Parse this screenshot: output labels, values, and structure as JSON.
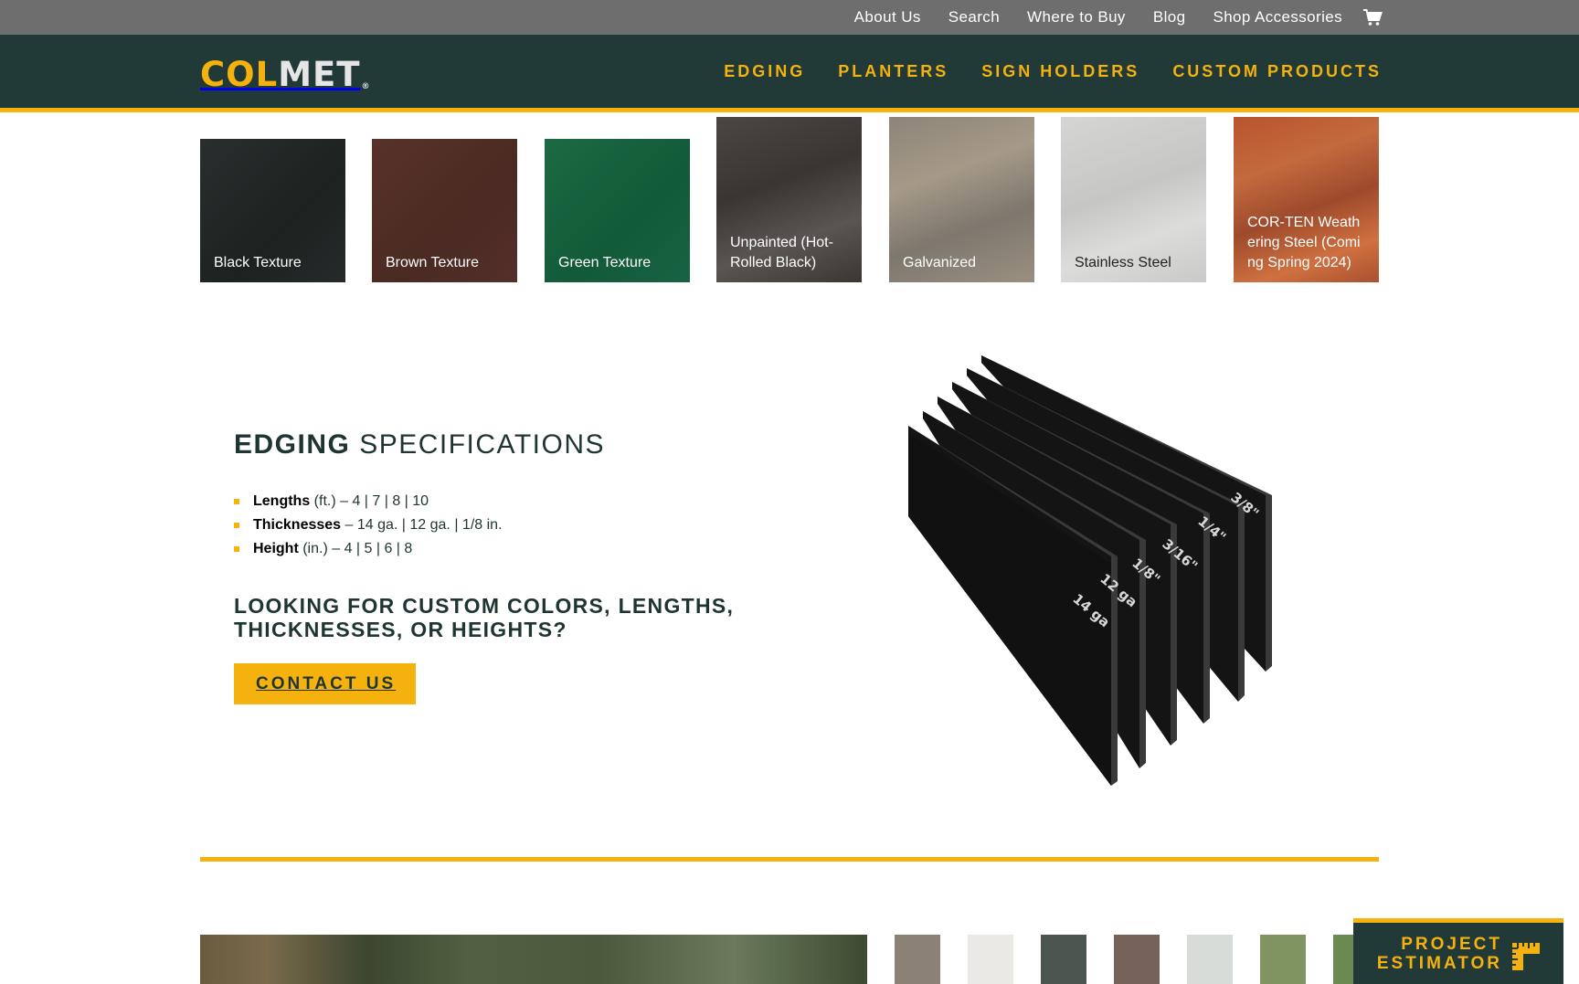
{
  "utility_nav": {
    "items": [
      "About Us",
      "Search",
      "Where to Buy",
      "Blog",
      "Shop Accessories"
    ],
    "cart_icon": "shopping-cart-icon"
  },
  "brand": {
    "logo_part1": "COL",
    "logo_part2": "MET",
    "logo_mark": "®",
    "accent": "#f5b20f",
    "dark": "#223a37"
  },
  "main_nav": {
    "items": [
      "EDGING",
      "PLANTERS",
      "SIGN HOLDERS",
      "CUSTOM PRODUCTS"
    ]
  },
  "swatches": [
    {
      "label": "Black Texture"
    },
    {
      "label": "Brown Texture"
    },
    {
      "label": "Green Texture"
    },
    {
      "label": "Unpainted (Hot-Rolled Black)"
    },
    {
      "label": "Galvanized"
    },
    {
      "label": "Stainless Steel"
    },
    {
      "label": "COR-TEN Weathering Steel (Coming Spring 2024)"
    }
  ],
  "specs": {
    "title_bold": "EDGING",
    "title_rest": " SPECIFICATIONS",
    "items": [
      {
        "name": "Lengths",
        "detail": " (ft.) – 4 | 7 | 8 | 10"
      },
      {
        "name": "Thicknesses",
        "detail": " – 14 ga. | 12 ga. | 1/8 in."
      },
      {
        "name": "Height",
        "detail": " (in.) – 4 | 5 | 6 | 8"
      }
    ],
    "custom_question": "LOOKING FOR CUSTOM COLORS, LENGTHS, THICKNESSES, OR HEIGHTS?",
    "contact_label": "CONTACT US"
  },
  "edging_graphic": {
    "labels": [
      "14 ga",
      "12 ga",
      "1/8\"",
      "3/16\"",
      "1/4\"",
      "3/8\""
    ]
  },
  "estimator": {
    "line1": "PROJECT",
    "line2": "ESTIMATOR",
    "icon": "ruler-icon"
  }
}
